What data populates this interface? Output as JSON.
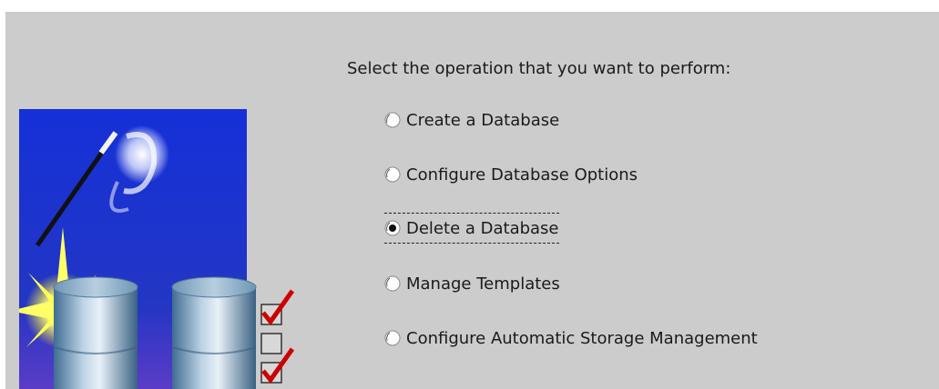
{
  "prompt": "Select the operation that you want to perform:",
  "options": [
    {
      "label": "Create a Database",
      "selected": false
    },
    {
      "label": "Configure Database Options",
      "selected": false
    },
    {
      "label": "Delete a Database",
      "selected": true
    },
    {
      "label": "Manage Templates",
      "selected": false
    },
    {
      "label": "Configure Automatic Storage Management",
      "selected": false
    }
  ],
  "colors": {
    "panel_background": "#cccccc",
    "illustration_sky": "#1b2fcf",
    "radio_fill": "#ffffff"
  }
}
